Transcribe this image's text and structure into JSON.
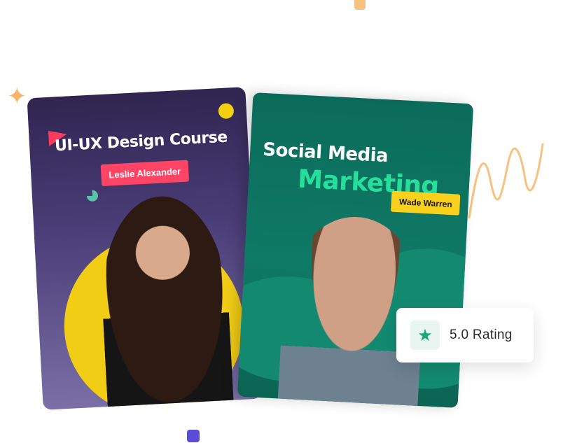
{
  "cards": {
    "ui_ux": {
      "title": "UI-UX Design Course",
      "instructor": "Leslie Alexander"
    },
    "social": {
      "title_line1": "Social Media",
      "title_line2": "Marketing",
      "instructor": "Wade Warren"
    }
  },
  "rating": {
    "icon": "star-icon",
    "value_label": "5.0  Rating"
  },
  "colors": {
    "ui_card_bg": "#3b3064",
    "social_card_bg": "#0f7a66",
    "accent_red": "#ff4466",
    "accent_yellow": "#f9d01c",
    "accent_green": "#25e09b",
    "deco_orange": "#f7b56a",
    "deco_purple": "#5b4dd6"
  }
}
